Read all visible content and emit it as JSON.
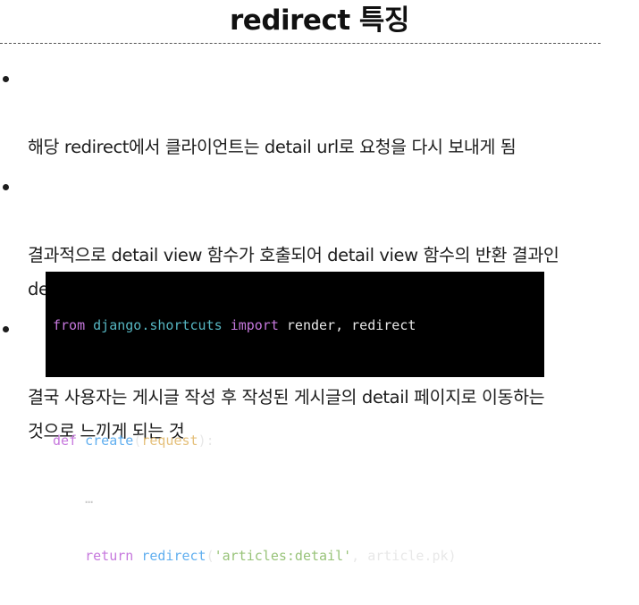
{
  "slide": {
    "title": "redirect 특징",
    "bullets": [
      "해당 redirect에서 클라이언트는 detail url로 요청을 다시 보내게 됨",
      "결과적으로 detail view 함수가 호출되어 detail view 함수의 반환 결과인\ndetail 페이지를 응답 받음",
      "결국 사용자는 게시글 작성 후 작성된 게시글의 detail 페이지로 이동하는\n것으로 느끼게 되는 것"
    ]
  },
  "code": {
    "line1": {
      "kw_from": "from",
      "module": "django.shortcuts",
      "kw_import": "import",
      "names": "render, redirect"
    },
    "line3": {
      "kw_def": "def",
      "func": "create",
      "open": "(",
      "param": "request",
      "close": "):"
    },
    "line4": {
      "ellipsis": "…"
    },
    "line5": {
      "kw_return": "return",
      "call": "redirect",
      "open": "(",
      "arg_str": "'articles:detail'",
      "sep": ", ",
      "arg_attr": "article.pk",
      "close": ")"
    }
  }
}
